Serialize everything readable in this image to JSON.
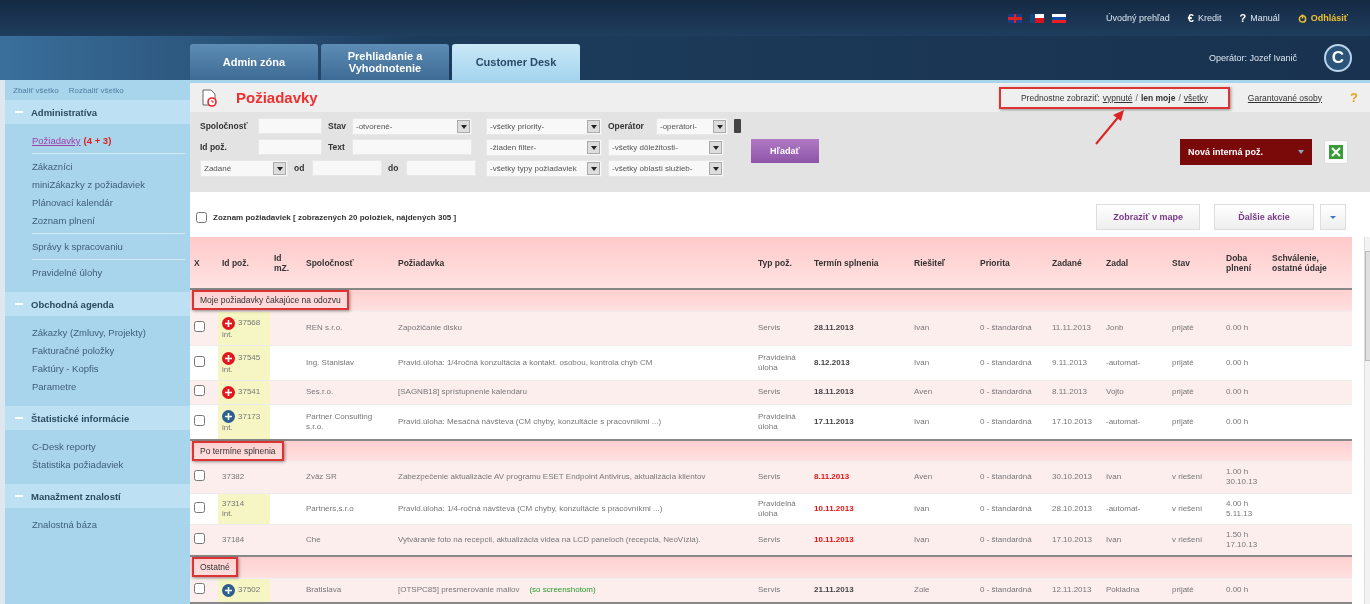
{
  "header": {
    "links": [
      {
        "kind": "overview",
        "label": "Úvodný prehľad"
      },
      {
        "kind": "credit",
        "label": "Kredit",
        "symbol": "€"
      },
      {
        "kind": "manual",
        "label": "Manuál",
        "symbol": "?"
      },
      {
        "kind": "logout",
        "label": "Odhlásiť"
      }
    ],
    "operator": "Operátor: Jozef Ivanič",
    "logo_letter": "C"
  },
  "tabs": [
    {
      "label": "Admin zóna",
      "selected": false
    },
    {
      "label": "Prehliadanie a Vyhodnotenie",
      "selected": false
    },
    {
      "label": "Customer Desk",
      "selected": true
    }
  ],
  "sidebar": {
    "collapse_all": "Zbaliť všetko",
    "expand_all": "Rozbaliť všetko",
    "sections": [
      {
        "title": "Administratíva",
        "expanded": true,
        "items": [
          {
            "label": "Požiadavky",
            "count": "(4 + 3)",
            "selected": true,
            "divider_after": true
          },
          {
            "label": "Zákazníci",
            "selected": false,
            "divider_after": false
          },
          {
            "label": "miniZákazky z požiadaviek",
            "selected": false,
            "divider_after": false
          },
          {
            "label": "Plánovací kalendár",
            "selected": false,
            "divider_after": false
          },
          {
            "label": "Zoznam plnení",
            "selected": false,
            "divider_after": true
          },
          {
            "label": "Správy k spracovaniu",
            "selected": false,
            "divider_after": true
          },
          {
            "label": "Pravidelné úlohy",
            "selected": false,
            "divider_after": false
          }
        ]
      },
      {
        "title": "Obchodná agenda",
        "expanded": true,
        "items": [
          {
            "label": "Zákazky (Zmluvy, Projekty)",
            "selected": false,
            "divider_after": false
          },
          {
            "label": "Fakturačné položky",
            "selected": false,
            "divider_after": false
          },
          {
            "label": "Faktúry - Kopfis",
            "selected": false,
            "divider_after": false
          },
          {
            "label": "Parametre",
            "selected": false,
            "divider_after": false
          }
        ]
      },
      {
        "title": "Štatistické informácie",
        "expanded": true,
        "items": [
          {
            "label": "C-Desk reporty",
            "selected": false,
            "divider_after": false
          },
          {
            "label": "Štatistika požiadaviek",
            "selected": false,
            "divider_after": false
          }
        ]
      },
      {
        "title": "Manažment znalostí",
        "expanded": true,
        "items": [
          {
            "label": "Znalostná báza",
            "selected": false,
            "divider_after": false
          }
        ]
      }
    ]
  },
  "page": {
    "title": "Požiadavky",
    "view_filter": {
      "label": "Prednostne zobraziť:",
      "highlighted": true,
      "separator": "/",
      "options": [
        {
          "label": "vypnuté",
          "selected": false
        },
        {
          "label": "len moje",
          "selected": true
        },
        {
          "label": "všetky",
          "selected": false
        }
      ]
    },
    "guarantors_link": "Garantované osoby",
    "help": "?"
  },
  "filters": {
    "company_label": "Spoločnosť",
    "status_label": "Stav",
    "status": "-otvorené-",
    "priority": "-všetky priority-",
    "operator_label": "Operátor",
    "operator": "-operátori-",
    "id_label": "Id pož.",
    "text_label": "Text",
    "saved_filter": "-žiaden filter-",
    "importance": "-všetky dôležitosti-",
    "date_type": "Zadané",
    "from_label": "od",
    "to_label": "do",
    "request_types": "-všetky typy požiadaviek",
    "service_areas": "-všetky oblasti služieb-",
    "search_button": "Hľadať",
    "new_button": "Nová interná pož."
  },
  "list": {
    "select_all_checked": false,
    "summary": "Zoznam požiadaviek [ zobrazených **20** položiek, nájdených **305** ]",
    "map_button": "Zobraziť v mape",
    "actions_button": "Ďalšie akcie"
  },
  "table": {
    "columns": [
      "X",
      "Id pož.",
      "Id mZ.",
      "Spoločnosť",
      "Požiadavka",
      "Typ pož.",
      "Termín splnenia",
      "Riešiteľ",
      "Priorita",
      "Zadané",
      "Zadal",
      "Stav",
      "Doba plnení",
      "Schválenie, ostatné údaje"
    ],
    "groups": [
      {
        "title": "Moje požiadavky čakajúce na odozvu",
        "highlighted": true,
        "rows": [
          {
            "checked": false,
            "color": "#e3161b",
            "id": "37568",
            "int": "int.",
            "highlighted": true,
            "company": "REN s.r.o.",
            "request": "Zapožičanie disku",
            "type": "Servis",
            "due": "28.11.2013",
            "overdue": false,
            "solver": "Ivan",
            "priority": "0 - štandardná",
            "created": "11.11.2013",
            "created_by": "Jonb",
            "status": "prijaté",
            "duration": "0.00 h"
          },
          {
            "checked": false,
            "color": "#e3161b",
            "id": "37545",
            "int": "int.",
            "highlighted": true,
            "company": "Ing. Stanislav",
            "request": "Pravid.úloha: 1/4ročná konzultácia a kontakt. osobou, kontrola chýb CM",
            "type": "Pravidelná úloha",
            "due": "8.12.2013",
            "overdue": false,
            "solver": "Ivan",
            "priority": "0 - štandardná",
            "created": "9.11.2013",
            "created_by": "-automat-",
            "status": "prijaté",
            "duration": "0.00 h"
          },
          {
            "checked": false,
            "color": "#e3161b",
            "id": "37541",
            "highlighted": true,
            "company": "Ses.r.o.",
            "request": "[SAGNB18] sprístupnenie kalendaru",
            "type": "Servis",
            "due": "18.11.2013",
            "overdue": false,
            "solver": "Aven",
            "priority": "0 - štandardná",
            "created": "8.11.2013",
            "created_by": "Vojto",
            "status": "prijaté",
            "duration": "0.00 h"
          },
          {
            "checked": false,
            "color": "#2c5f8f",
            "id": "37173",
            "int": "int.",
            "highlighted": true,
            "company": "Partner Consulting s.r.o.",
            "request": "Pravid.úloha: Mesačná návšteva (CM chyby, konzultácie s pracovníkmi ...)",
            "type": "Pravidelná úloha",
            "due": "17.11.2013",
            "overdue": false,
            "solver": "Ivan",
            "priority": "0 - štandardná",
            "created": "17.10.2013",
            "created_by": "-automat-",
            "status": "prijaté",
            "duration": "0.00 h"
          }
        ]
      },
      {
        "title": "Po termíne splnenia",
        "highlighted": true,
        "rows": [
          {
            "checked": false,
            "id": "37382",
            "highlighted": false,
            "company": "Zväz SR",
            "request": "Zabezpečenie aktualizácie AV programu ESET Endpoint Antivirus, aktualizácia klientov",
            "type": "Servis",
            "due": "8.11.2013",
            "overdue": true,
            "solver": "Aven",
            "priority": "0 - štandardná",
            "created": "30.10.2013",
            "created_by": "Ivan",
            "status": "v riešení",
            "duration": "1.00 h",
            "duration_date": "30.10.13"
          },
          {
            "checked": false,
            "id": "37314",
            "int": "int.",
            "highlighted": true,
            "company": "Partners,s.r.o",
            "request": "Pravid.úloha: 1/4-ročná návšteva (CM chyby, konzultácie s pracovníkmi ...)",
            "type": "Pravidelná úloha",
            "due": "10.11.2013",
            "overdue": true,
            "solver": "Ivan",
            "priority": "0 - štandardná",
            "created": "28.10.2013",
            "created_by": "-automat-",
            "status": "v riešení",
            "duration": "4.00 h",
            "duration_date": "5.11.13"
          },
          {
            "checked": false,
            "id": "37184",
            "highlighted": false,
            "company": "Che",
            "request": "Vytváranie foto na recepcii, aktualizácia videa na LCD paneloch (recepcia, NeoVízia).",
            "type": "Servis",
            "due": "10.11.2013",
            "overdue": true,
            "solver": "Ivan",
            "priority": "0 - štandardná",
            "created": "17.10.2013",
            "created_by": "Ivan",
            "status": "v riešení",
            "duration": "1.50 h",
            "duration_date": "17.10.13"
          }
        ]
      },
      {
        "title": "Ostatné",
        "highlighted": true,
        "rows": [
          {
            "checked": false,
            "color": "#2c5f8f",
            "id": "37502",
            "highlighted": true,
            "company": "Bratislava",
            "request": "[OTSPC85] presmerovanie mailov",
            "note": "(so screenshotom)",
            "type": "Servis",
            "due": "21.11.2013",
            "overdue": false,
            "solver": "Zole",
            "priority": "0 - štandardná",
            "created": "12.11.2013",
            "created_by": "Pokladna",
            "status": "prijaté",
            "duration": "0.00 h"
          }
        ]
      }
    ]
  }
}
